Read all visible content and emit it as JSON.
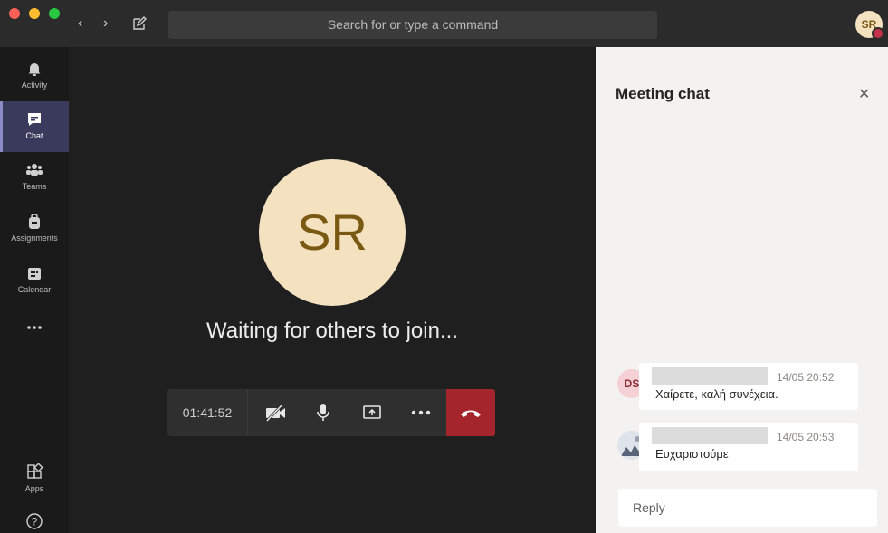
{
  "titlebar": {
    "search_placeholder": "Search for or type a command",
    "user_initials": "SR"
  },
  "rail": {
    "items": [
      {
        "label": "Activity",
        "icon": "bell-icon"
      },
      {
        "label": "Chat",
        "icon": "chat-icon",
        "active": true
      },
      {
        "label": "Teams",
        "icon": "teams-icon"
      },
      {
        "label": "Assignments",
        "icon": "backpack-icon"
      },
      {
        "label": "Calendar",
        "icon": "calendar-icon"
      },
      {
        "label": "",
        "icon": "more-icon"
      },
      {
        "label": "Apps",
        "icon": "apps-icon"
      },
      {
        "label": "",
        "icon": "help-icon"
      }
    ]
  },
  "stage": {
    "avatar_initials": "SR",
    "waiting_text": "Waiting for others to join...",
    "timer": "01:41:52"
  },
  "chat": {
    "title": "Meeting chat",
    "messages": [
      {
        "initials": "DS",
        "time": "14/05 20:52",
        "text": "Χαίρετε, καλή συνέχεια."
      },
      {
        "initials": "",
        "time": "14/05 20:53",
        "text": "Ευχαριστούμε"
      }
    ],
    "reply_placeholder": "Reply"
  },
  "colors": {
    "accent": "#8b8cc7",
    "hangup": "#a4262c",
    "avatar_bg": "#f3e1c0",
    "presence_busy": "#c4314b",
    "presence_available": "#6bb700"
  }
}
